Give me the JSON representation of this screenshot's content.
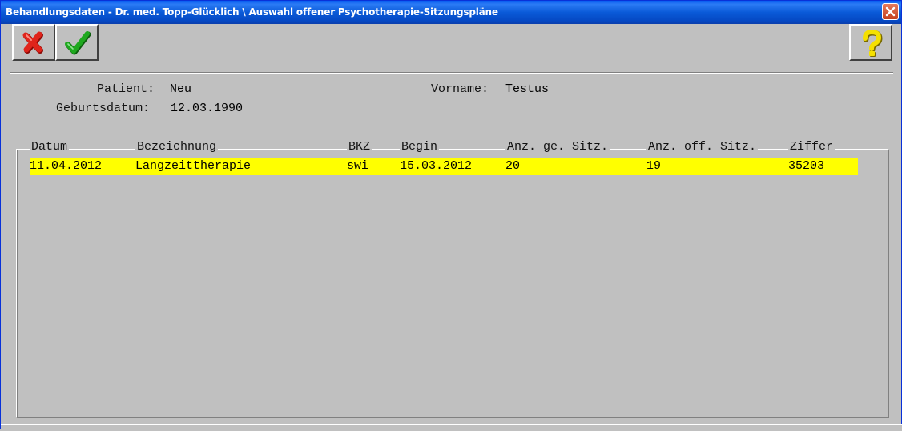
{
  "window": {
    "title": "Behandlungsdaten - Dr. med. Topp-Glücklich \\ Auswahl offener Psychotherapie-Sitzungspläne"
  },
  "toolbar": {
    "cancel_icon": "red-x-icon",
    "confirm_icon": "green-check-icon",
    "help_icon": "yellow-question-icon",
    "colors": {
      "cancel": "#e0241b",
      "confirm": "#1fa81f",
      "help": "#f5e000"
    }
  },
  "patient": {
    "patient_label": "Patient:",
    "patient_value": "Neu",
    "vorname_label": "Vorname:",
    "vorname_value": "Testus",
    "geburtsdatum_label": "Geburtsdatum:",
    "geburtsdatum_value": "12.03.1990"
  },
  "table": {
    "columns": [
      "Datum",
      "Bezeichnung",
      "BKZ",
      "Begin",
      "Anz. ge. Sitz.",
      "Anz. off. Sitz.",
      "Ziffer"
    ],
    "rows": [
      [
        "11.04.2012",
        "Langzeittherapie",
        "swi",
        "15.03.2012",
        "20",
        "19",
        "35203"
      ]
    ],
    "selected_row_color": "#ffff00"
  }
}
